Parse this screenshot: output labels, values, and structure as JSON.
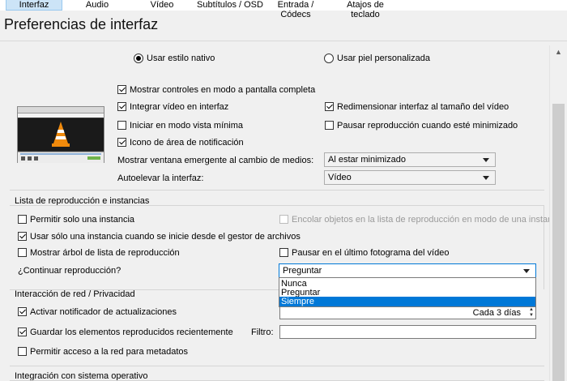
{
  "tabs": [
    "Interfaz",
    "Audio",
    "Vídeo",
    "Subtítulos / OSD",
    "Entrada / Códecs",
    "Atajos de teclado"
  ],
  "title": "Preferencias de interfaz",
  "look": {
    "native": "Usar estilo nativo",
    "skin": "Usar piel personalizada"
  },
  "options": {
    "fullscreen_controls": "Mostrar controles en modo a pantalla completa",
    "integrate_video": "Integrar vídeo en interfaz",
    "resize_interface": "Redimensionar interfaz al tamaño del vídeo",
    "minimal_view": "Iniciar en modo vista mínima",
    "pause_minimized": "Pausar reproducción cuando esté minimizado",
    "systray_icon": "Icono de área de notificación",
    "popup_label": "Mostrar ventana emergente al cambio de medios:",
    "popup_value": "Al estar minimizado",
    "raise_label": "Autoelevar la interfaz:",
    "raise_value": "Vídeo"
  },
  "playlist": {
    "header": "Lista de reproducción e instancias",
    "one_instance": "Permitir solo una instancia",
    "enqueue": "Encolar objetos en la lista de reproducción en modo de una instancia",
    "file_manager": "Usar sólo una instancia cuando se inicie desde el gestor de archivos",
    "tree": "Mostrar árbol de lista de reproducción",
    "pause_last": "Pausar en el último fotograma del vídeo",
    "continue_label": "¿Continuar reproducción?",
    "continue_value": "Preguntar",
    "continue_options": [
      "Nunca",
      "Preguntar",
      "Siempre"
    ]
  },
  "network": {
    "header": "Interacción de red / Privacidad",
    "updates": "Activar notificador de actualizaciones",
    "update_interval": "Cada 3 días",
    "recent": "Guardar los elementos reproducidos recientemente",
    "filter_label": "Filtro:",
    "metadata": "Permitir acceso a la red para metadatos"
  },
  "os": {
    "header": "Integración con sistema operativo"
  }
}
